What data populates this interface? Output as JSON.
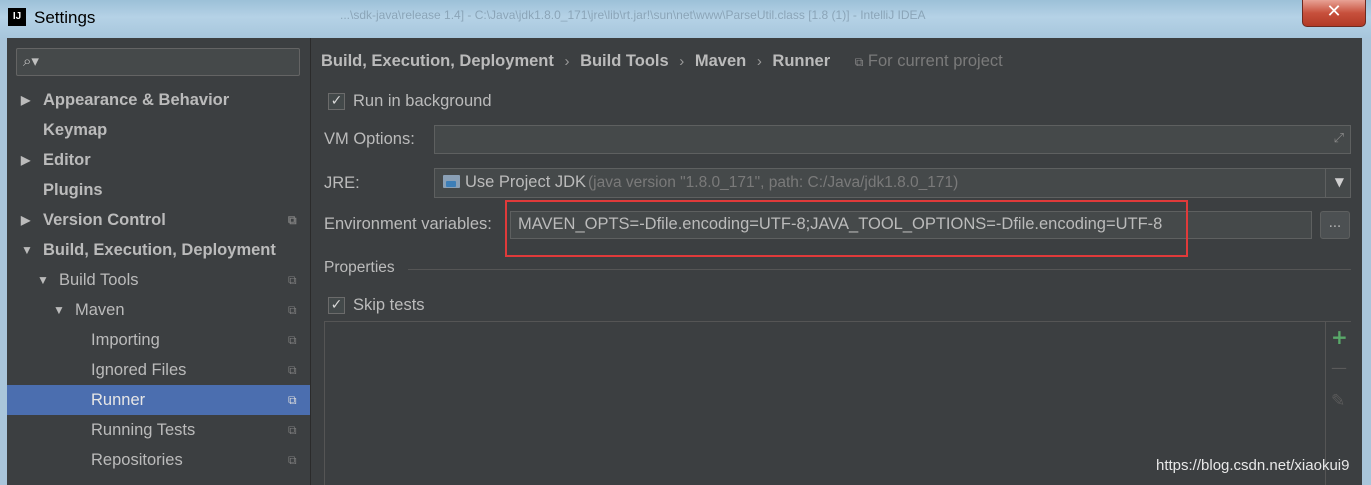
{
  "window": {
    "title": "Settings",
    "logo_text": "IJ",
    "close_glyph": "✕",
    "background_title": "...\\sdk-java\\release 1.4] - C:\\Java\\jdk1.8.0_171\\jre\\lib\\rt.jar!\\sun\\net\\www\\ParseUtil.class [1.8 (1)] - IntelliJ IDEA"
  },
  "search": {
    "icon": "search-icon",
    "placeholder": ""
  },
  "tree": [
    {
      "label": "Appearance & Behavior",
      "arrow": "▶",
      "bold": true,
      "project_icon": false
    },
    {
      "label": "Keymap",
      "arrow": "",
      "bold": true,
      "project_icon": false
    },
    {
      "label": "Editor",
      "arrow": "▶",
      "bold": true,
      "project_icon": false
    },
    {
      "label": "Plugins",
      "arrow": "",
      "bold": true,
      "project_icon": false
    },
    {
      "label": "Version Control",
      "arrow": "▶",
      "bold": true,
      "project_icon": true
    },
    {
      "label": "Build, Execution, Deployment",
      "arrow": "▼",
      "bold": true,
      "project_icon": false
    },
    {
      "label": "Build Tools",
      "arrow": "▼",
      "bold": false,
      "project_icon": true
    },
    {
      "label": "Maven",
      "arrow": "▼",
      "bold": false,
      "project_icon": true
    },
    {
      "label": "Importing",
      "arrow": "",
      "bold": false,
      "project_icon": true
    },
    {
      "label": "Ignored Files",
      "arrow": "",
      "bold": false,
      "project_icon": true
    },
    {
      "label": "Runner",
      "arrow": "",
      "bold": false,
      "project_icon": true,
      "selected": true
    },
    {
      "label": "Running Tests",
      "arrow": "",
      "bold": false,
      "project_icon": true
    },
    {
      "label": "Repositories",
      "arrow": "",
      "bold": false,
      "project_icon": true
    }
  ],
  "breadcrumb": {
    "items": [
      "Build, Execution, Deployment",
      "Build Tools",
      "Maven",
      "Runner"
    ],
    "separator": "›",
    "scope": "For current project"
  },
  "runner": {
    "run_in_background": {
      "label": "Run in background",
      "checked": true
    },
    "vm_options": {
      "label": "VM Options:",
      "value": ""
    },
    "jre": {
      "label": "JRE:",
      "value": "Use Project JDK",
      "detail": "(java version \"1.8.0_171\", path: C:/Java/jdk1.8.0_171)"
    },
    "env": {
      "label": "Environment variables:",
      "value": "MAVEN_OPTS=-Dfile.encoding=UTF-8;JAVA_TOOL_OPTIONS=-Dfile.encoding=UTF-8",
      "browse_label": "..."
    },
    "properties_label": "Properties",
    "skip_tests": {
      "label": "Skip tests",
      "checked": true
    }
  },
  "properties_toolbar": {
    "add": "+",
    "remove": "—",
    "edit": "✎"
  },
  "watermark": "https://blog.csdn.net/xiaokui9",
  "colors": {
    "background": "#3c3f41",
    "selection": "#4b6eaf",
    "highlight_box": "#e03a3a",
    "add_icon": "#59a869"
  }
}
